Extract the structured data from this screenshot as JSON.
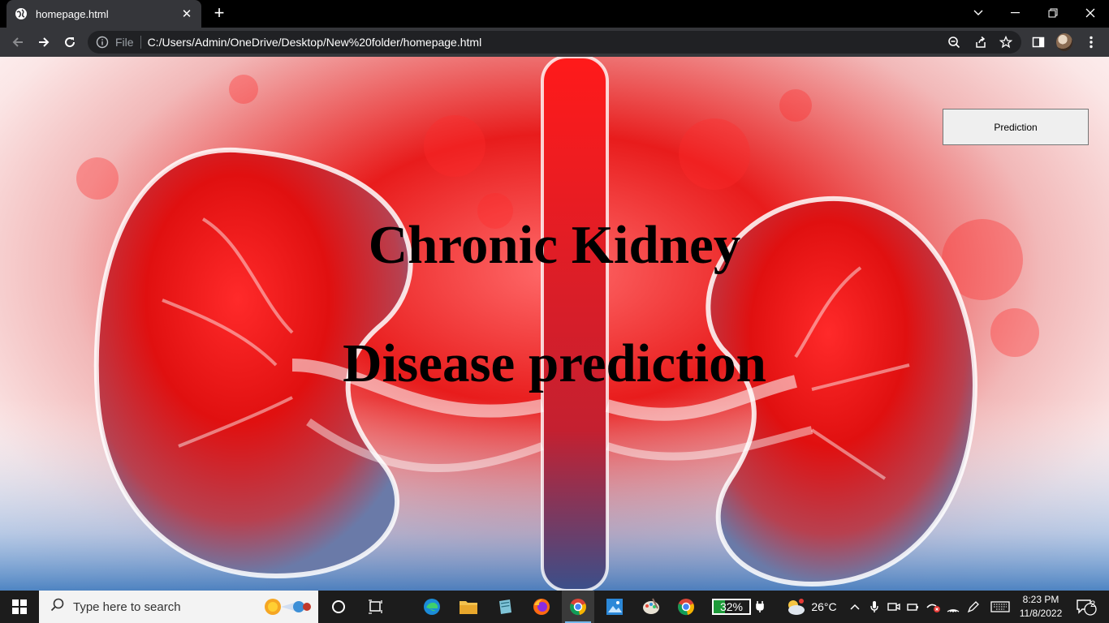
{
  "browser": {
    "tab_title": "homepage.html",
    "address_label": "File",
    "url": "C:/Users/Admin/OneDrive/Desktop/New%20folder/homepage.html"
  },
  "page": {
    "heading_line1": "Chronic Kidney",
    "heading_line2": "Disease prediction",
    "prediction_button": "Prediction",
    "background_image": "kidney-illustration"
  },
  "taskbar": {
    "search_placeholder": "Type here to search",
    "battery_percent": "32%",
    "weather_temp": "26°C",
    "time": "8:23 PM",
    "date": "11/8/2022",
    "notification_count": "2",
    "pinned_apps": [
      "edge-icon",
      "file-explorer-icon",
      "notepad-icon",
      "firefox-icon",
      "chrome-active-icon",
      "photos-icon",
      "paint-icon",
      "chrome-icon"
    ]
  },
  "colors": {
    "kidney_red": "#e81c1c",
    "chrome_dark": "#35363a",
    "taskbar_dark": "#1c1c1c",
    "battery_green": "#1e9b3a"
  }
}
